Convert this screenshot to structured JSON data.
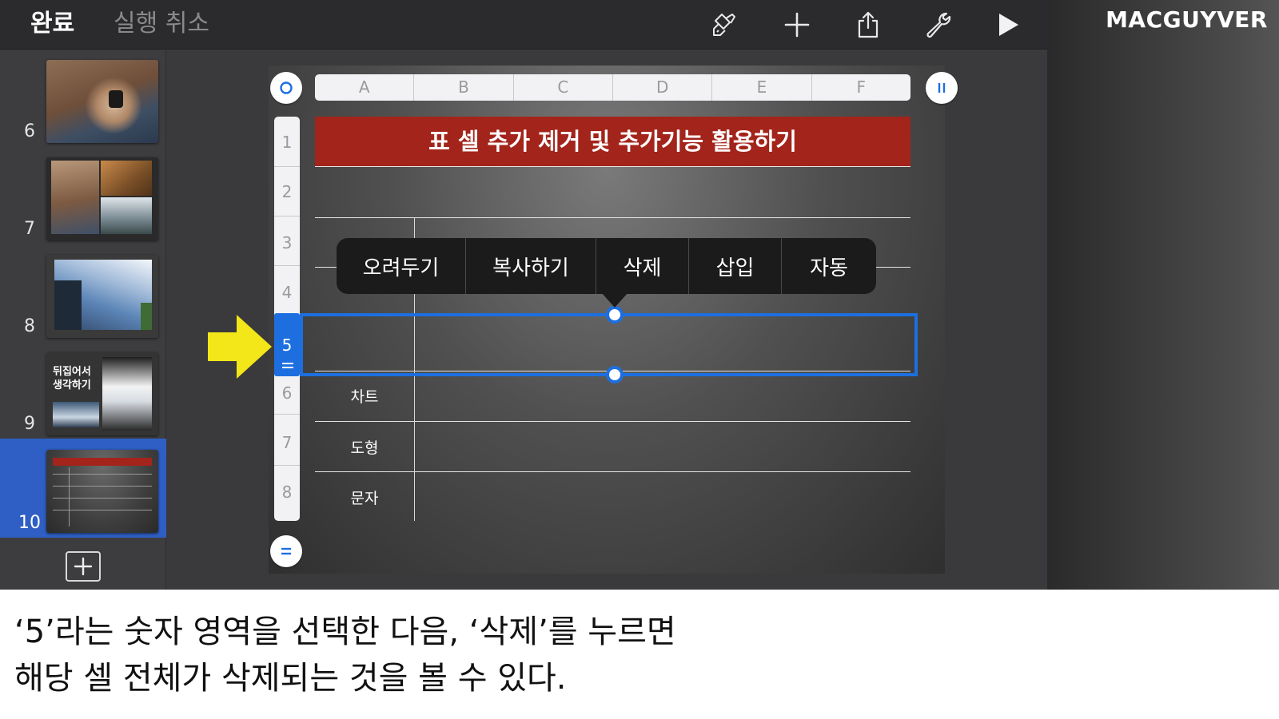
{
  "toolbar": {
    "done_label": "완료",
    "undo_label": "실행 취소",
    "icons": [
      "format-brush-icon",
      "plus-icon",
      "share-icon",
      "wrench-icon",
      "play-icon"
    ]
  },
  "brand": "MACGUYVER",
  "slides": [
    {
      "number": "6",
      "caption": ""
    },
    {
      "number": "7",
      "caption": ""
    },
    {
      "number": "8",
      "caption": ""
    },
    {
      "number": "9",
      "caption": "뒤집어서\n생각하기"
    },
    {
      "number": "10",
      "caption": "",
      "selected": true
    }
  ],
  "table": {
    "columns": [
      "A",
      "B",
      "C",
      "D",
      "E",
      "F"
    ],
    "rows": [
      "1",
      "2",
      "3",
      "4",
      "5",
      "6",
      "7",
      "8"
    ],
    "selected_row": "5",
    "title": "표 셀 추가 제거 및 추가기능 활용하기",
    "cell_labels": {
      "row6": "차트",
      "row7": "도형",
      "row8": "문자"
    }
  },
  "context_menu": [
    "오려두기",
    "복사하기",
    "삭제",
    "삽입",
    "자동"
  ],
  "caption": {
    "line1": "‘5’라는 숫자 영역을 선택한 다음, ‘삭제’를 누르면",
    "line2": "해당 셀 전체가 삭제되는 것을 볼 수 있다."
  },
  "colors": {
    "accent": "#1d6fe0",
    "slide_selected": "#2f5fc4",
    "title_band": "#a3241a",
    "arrow": "#f3e619"
  }
}
